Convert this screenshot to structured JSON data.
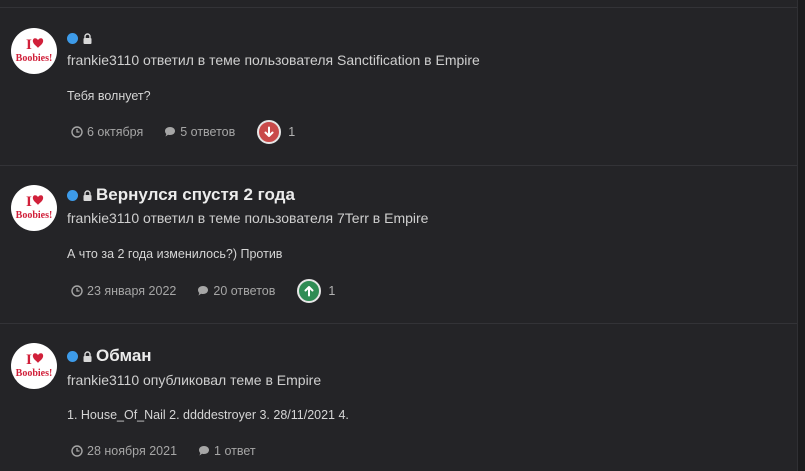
{
  "colors": {
    "unread_dot": "#3d9be9",
    "downvote": "#c94a4a",
    "upvote": "#2f8c54",
    "background": "#242427",
    "avatar_text": "#d1203a"
  },
  "avatar": {
    "line1": "I",
    "line2": "Boobies!"
  },
  "items": [
    {
      "title": "",
      "action": "frankie3110 ответил в теме пользователя Sanctification в Empire",
      "snippet": "Тебя волнует?",
      "date": "6 октября",
      "replies": "5 ответов",
      "reaction": "downvote-icon",
      "reaction_count": "1"
    },
    {
      "title": "Вернулся спустя 2 года",
      "action": "frankie3110 ответил в теме пользователя 7Terr в Empire",
      "snippet": "А что за 2 года изменилось?) Против",
      "date": "23 января 2022",
      "replies": "20 ответов",
      "reaction": "upvote-icon",
      "reaction_count": "1"
    },
    {
      "title": "Обман",
      "action": "frankie3110 опубликовал теме в Empire",
      "snippet": "1. House_Of_Nail 2. ddddestroyer 3. 28/11/2021 4.",
      "date": "28 ноября 2021",
      "replies": "1 ответ"
    }
  ]
}
